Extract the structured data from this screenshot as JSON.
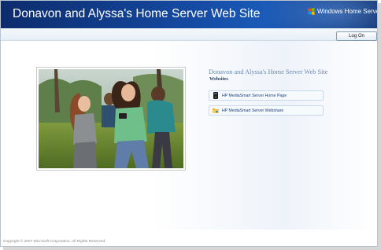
{
  "header": {
    "site_title": "Donavon and Alyssa's Home Server Web Site",
    "brand_label": "Windows Home Server",
    "brand_icon": "windows-flag-icon"
  },
  "toolbar": {
    "logon_label": "Log On"
  },
  "main": {
    "panel_title": "Donavon and Alyssa's Home Server Web Site",
    "panel_subtitle": "Websites",
    "links": [
      {
        "label": "HP MediaSmart Server Home Page",
        "icon": "server-icon"
      },
      {
        "label": "HP MediaSmart Server Webshare",
        "icon": "folder-share-icon"
      }
    ]
  },
  "footer": {
    "copyright": "Copyright © 2007 Microsoft Corporation. All Rights Reserved."
  },
  "colors": {
    "header_dark": "#0d2c6c",
    "header_light": "#1a5ab8",
    "panel_title": "#6c8ab0",
    "link_text": "#1a3f7a"
  }
}
